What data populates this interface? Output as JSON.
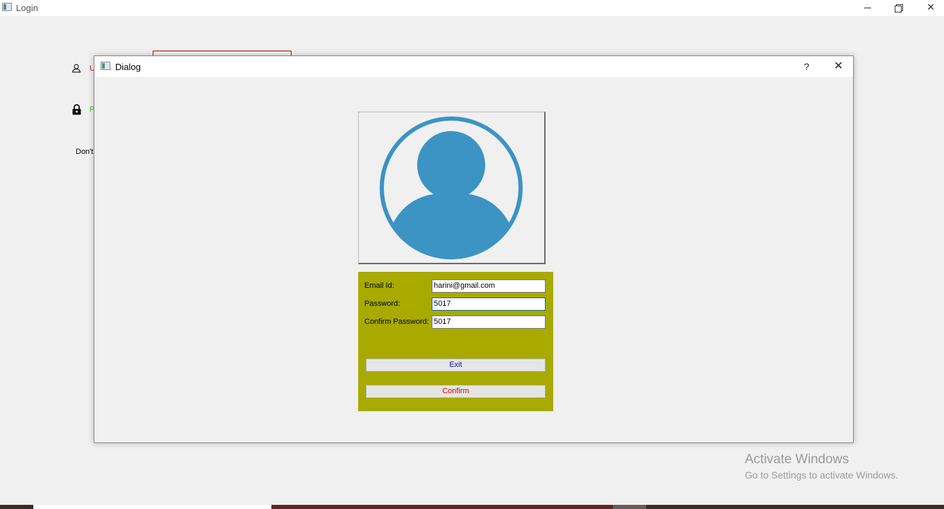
{
  "window": {
    "title": "Login",
    "minimize_label": "─",
    "maximize_label": "",
    "close_label": "✕"
  },
  "background": {
    "username_label": "U",
    "password_label": "P",
    "dont_text": "Don't"
  },
  "dialog": {
    "title": "Dialog",
    "help_label": "?",
    "close_label": "✕",
    "form": {
      "email_label": "Email Id:",
      "email_value": "harini@gmail.com",
      "password_label": "Password:",
      "password_value": "5017",
      "confirm_label": "Confirm Password:",
      "confirm_value": "5017",
      "exit_label": "Exit",
      "confirm_button_label": "Confirm"
    },
    "colors": {
      "form_bg": "#a8aa00",
      "avatar": "#3b94c4"
    }
  },
  "watermark": {
    "title": "Activate Windows",
    "subtitle": "Go to Settings to activate Windows."
  }
}
